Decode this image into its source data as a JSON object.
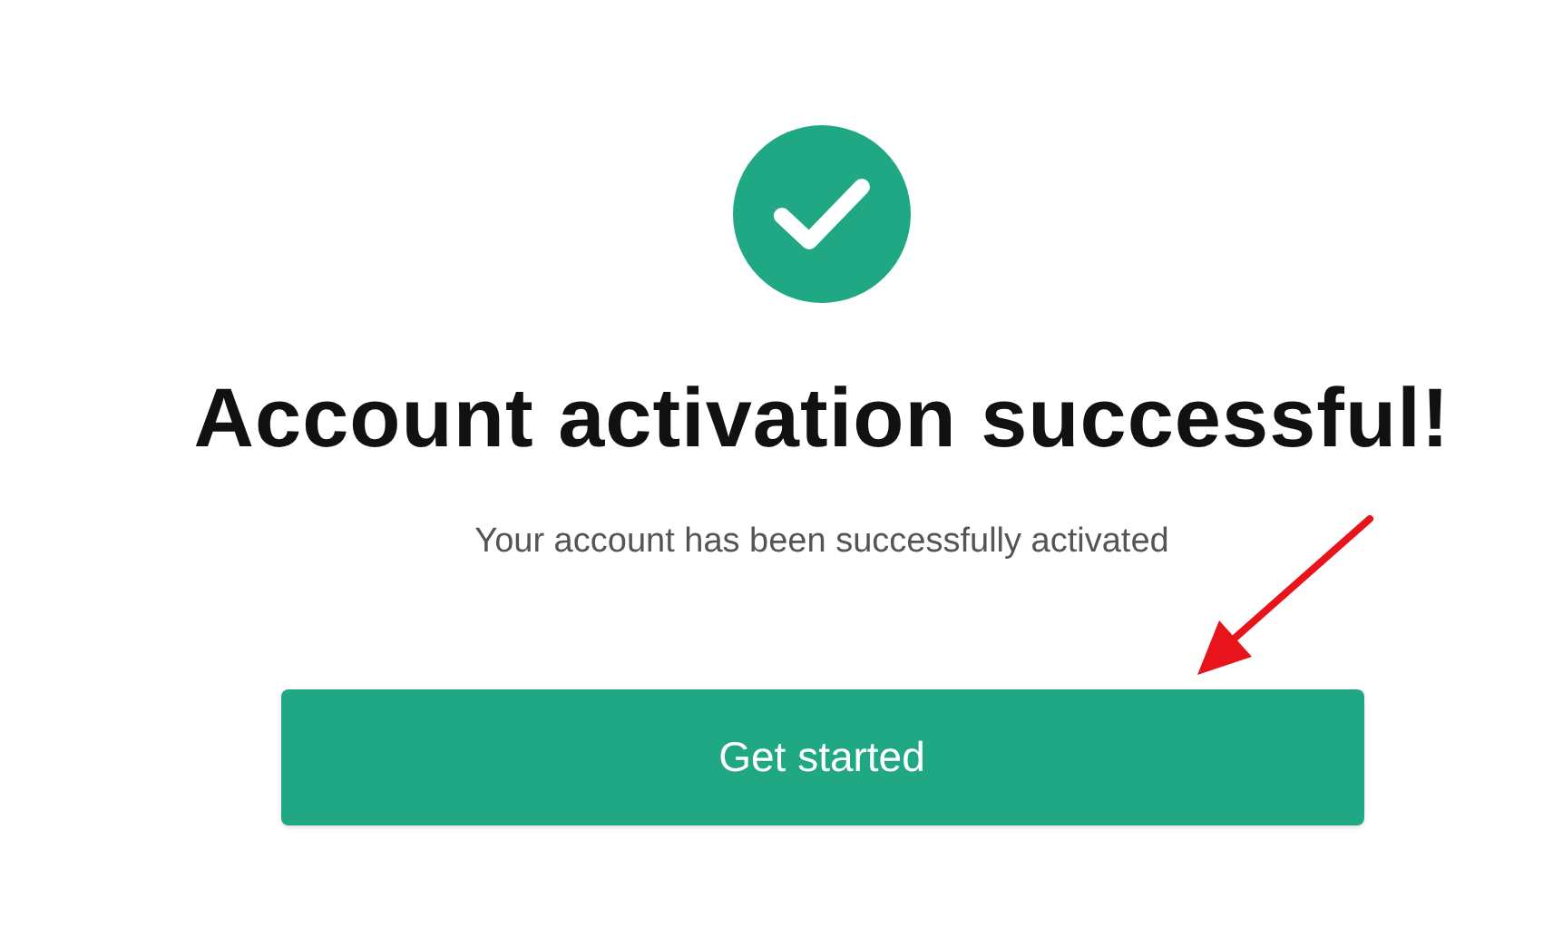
{
  "title": "Account activation successful!",
  "message": "Your account has been successfully activated",
  "button": {
    "label": "Get started"
  }
}
